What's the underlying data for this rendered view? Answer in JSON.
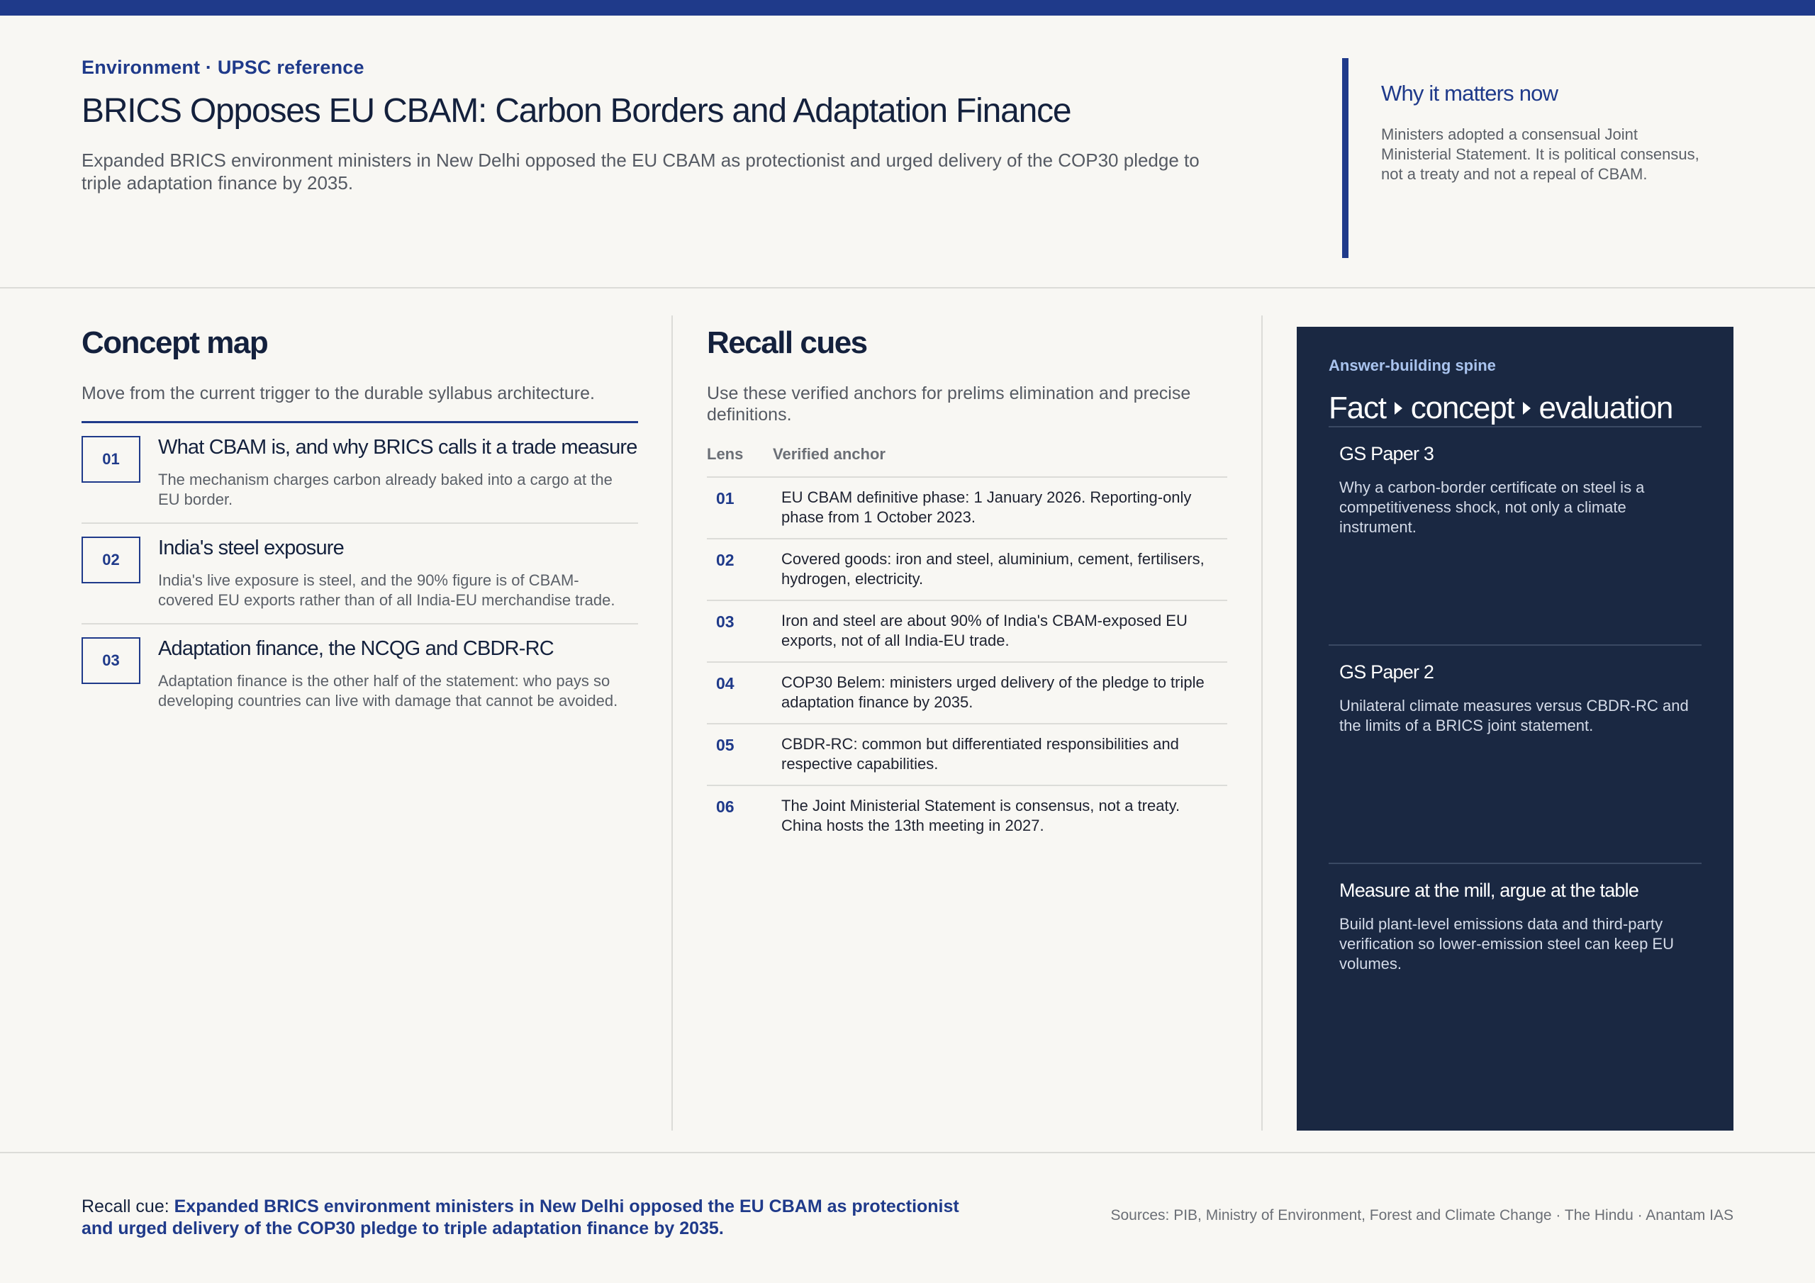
{
  "header": {
    "eyebrow": "Environment · UPSC reference",
    "title": "BRICS Opposes EU CBAM: Carbon Borders and Adaptation Finance",
    "subtitle": "Expanded BRICS environment ministers in New Delhi opposed the EU CBAM as protectionist and urged delivery of the COP30 pledge to triple adaptation finance by 2035."
  },
  "why": {
    "title": "Why it matters now",
    "body": "Ministers adopted a consensual Joint Ministerial Statement. It is political consensus, not a treaty and not a repeal of CBAM."
  },
  "concept_map": {
    "title": "Concept map",
    "lead": "Move from the current trigger to the durable syllabus architecture.",
    "items": [
      {
        "num": "01",
        "head": "What CBAM is, and why BRICS calls it a trade measure",
        "body": "The mechanism charges carbon already baked into a cargo at the EU border."
      },
      {
        "num": "02",
        "head": "India's steel exposure",
        "body": "India's live exposure is steel, and the 90% figure is of CBAM-covered EU exports rather than of all India-EU merchandise trade."
      },
      {
        "num": "03",
        "head": "Adaptation finance, the NCQG and CBDR-RC",
        "body": "Adaptation finance is the other half of the statement: who pays so developing countries can live with damage that cannot be avoided."
      }
    ]
  },
  "recall": {
    "title": "Recall cues",
    "lead": "Use these verified anchors for prelims elimination and precise definitions.",
    "col_lens": "Lens",
    "col_anchor": "Verified anchor",
    "rows": [
      {
        "num": "01",
        "text": "EU CBAM definitive phase: 1 January 2026. Reporting-only phase from 1 October 2023."
      },
      {
        "num": "02",
        "text": "Covered goods: iron and steel, aluminium, cement, fertilisers, hydrogen, electricity."
      },
      {
        "num": "03",
        "text": "Iron and steel are about 90% of India's CBAM-exposed EU exports, not of all India-EU trade."
      },
      {
        "num": "04",
        "text": "COP30 Belem: ministers urged delivery of the pledge to triple adaptation finance by 2035."
      },
      {
        "num": "05",
        "text": "CBDR-RC: common but differentiated responsibilities and respective capabilities."
      },
      {
        "num": "06",
        "text": "The Joint Ministerial Statement is consensus, not a treaty. China hosts the 13th meeting in 2027."
      }
    ]
  },
  "spine": {
    "label": "Answer-building spine",
    "title_parts": [
      "Fact",
      "concept",
      "evaluation"
    ],
    "cards": [
      {
        "title": "GS Paper 3",
        "body": "Why a carbon-border certificate on steel is a competitiveness shock, not only a climate instrument."
      },
      {
        "title": "GS Paper 2",
        "body": "Unilateral climate measures versus CBDR-RC and the limits of a BRICS joint statement."
      },
      {
        "title": "Measure at the mill, argue at the table",
        "body": "Build plant-level emissions data and third-party verification so lower-emission steel can keep EU volumes."
      }
    ]
  },
  "footer": {
    "recall_label": "Recall cue: ",
    "recall_text": "Expanded BRICS environment ministers in New Delhi opposed the EU CBAM as protectionist and urged delivery of the COP30 pledge to triple adaptation finance by 2035.",
    "sources": "Sources: PIB, Ministry of Environment, Forest and Climate Change · The Hindu · Anantam IAS"
  }
}
